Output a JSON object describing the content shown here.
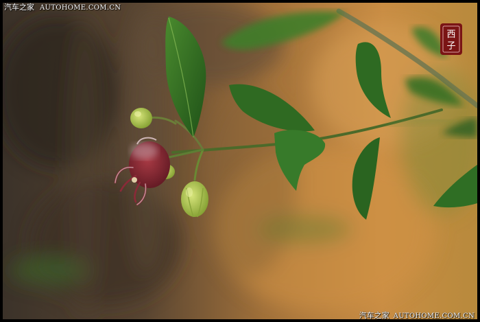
{
  "watermark_top": {
    "cn": "汽车之家",
    "en": "AUTOHOME.COM.CN"
  },
  "watermark_bottom": {
    "cn": "汽车之家",
    "en": "AUTOHOME.COM.CN"
  },
  "seal": {
    "text": "西子"
  },
  "colors": {
    "bg_dark": "#3a3128",
    "bg_orange": "#c78a3e",
    "leaf": "#2f6e24",
    "flower": "#7a1f2a",
    "bud": "#a8c24a"
  }
}
